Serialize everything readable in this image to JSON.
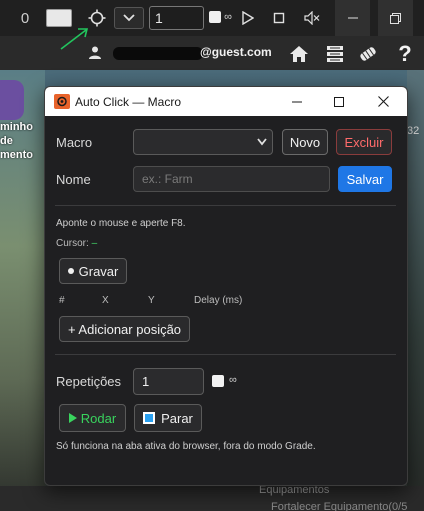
{
  "toolbar": {
    "zero_label": "0",
    "count_value": "1",
    "infinite_label": "∞",
    "icons": [
      "zero-icon",
      "color-swatch",
      "crosshair-icon",
      "chevron-down-icon",
      "play-icon",
      "stop-icon",
      "mute-icon",
      "minimize-icon",
      "restore-icon"
    ]
  },
  "site": {
    "email_suffix": "@guest.com",
    "nav_icons": [
      "home-icon",
      "list-icon",
      "coin-icon",
      "help-icon"
    ],
    "help_label": "?"
  },
  "background": {
    "left_label": "minho\nde\nmento",
    "right_number": "32",
    "equip_line_1": "Equipamentos",
    "equip_line_2": "Fortalecer Equipamento(0/5"
  },
  "dialog": {
    "title": "Auto Click — Macro",
    "macro_label": "Macro",
    "macro_selected": "",
    "novo_label": "Novo",
    "excluir_label": "Excluir",
    "name_label": "Nome",
    "name_placeholder": "ex.: Farm",
    "salvar_label": "Salvar",
    "hint": "Aponte o mouse e aperte F8.",
    "cursor_label": "Cursor:",
    "cursor_value": "–",
    "gravar_label": "Gravar",
    "columns": [
      "#",
      "X",
      "Y",
      "Delay (ms)"
    ],
    "add_position_label": "+ Adicionar posição",
    "repeticoes_label": "Repetições",
    "repeticoes_value": "1",
    "infinite_label": "∞",
    "rodar_label": "Rodar",
    "parar_label": "Parar",
    "footnote": "Só funciona na aba ativa do browser, fora do modo Grade."
  },
  "colors": {
    "accent_blue": "#1f77e6",
    "danger_red": "#ff6b6b",
    "run_green": "#39d45e",
    "annotation_arrow": "#22c55e"
  }
}
